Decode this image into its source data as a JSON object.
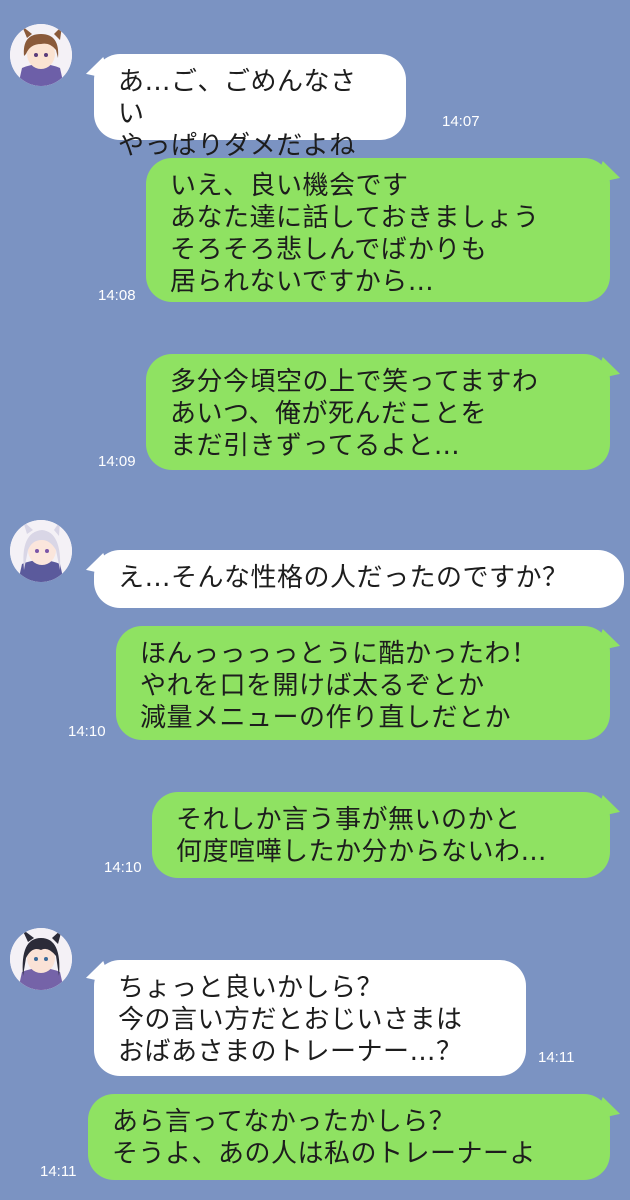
{
  "messages": [
    {
      "id": "m1",
      "side": "left",
      "text": "あ…ご、ごめんなさい\nやっぱりダメだよね",
      "time": "14:07"
    },
    {
      "id": "m2",
      "side": "right",
      "text": "いえ、良い機会です\nあなた達に話しておきましょう\nそろそろ悲しんでばかりも\n居られないですから…",
      "time": "14:08"
    },
    {
      "id": "m3",
      "side": "right",
      "text": "多分今頃空の上で笑ってますわ\nあいつ、俺が死んだことを\nまだ引きずってるよと…",
      "time": "14:09"
    },
    {
      "id": "m4",
      "side": "left",
      "text": "え…そんな性格の人だったのですか？",
      "time": ""
    },
    {
      "id": "m5",
      "side": "right",
      "text": "ほんっっっっとうに酷かったわ！\nやれを口を開けば太るぞとか\n減量メニューの作り直しだとか",
      "time": "14:10"
    },
    {
      "id": "m6",
      "side": "right",
      "text": "それしか言う事が無いのかと\n何度喧嘩したか分からないわ…",
      "time": "14:10"
    },
    {
      "id": "m7",
      "side": "left",
      "text": "ちょっと良いかしら？\n今の言い方だとおじいさまは\nおばあさまのトレーナー…？",
      "time": "14:11"
    },
    {
      "id": "m8",
      "side": "right",
      "text": "あら言ってなかったかしら？\nそうよ、あの人は私のトレーナーよ",
      "time": "14:11"
    }
  ],
  "avatars": [
    {
      "icon": "brown-haired-character-avatar-icon",
      "hair": "#8a5a3a"
    },
    {
      "icon": "silver-haired-character-avatar-icon",
      "hair": "#d9d6e6"
    },
    {
      "icon": "dark-haired-character-avatar-icon",
      "hair": "#2b2b38"
    }
  ],
  "colors": {
    "background": "#7b93c2",
    "sent": "#8fe262",
    "received": "#ffffff"
  }
}
